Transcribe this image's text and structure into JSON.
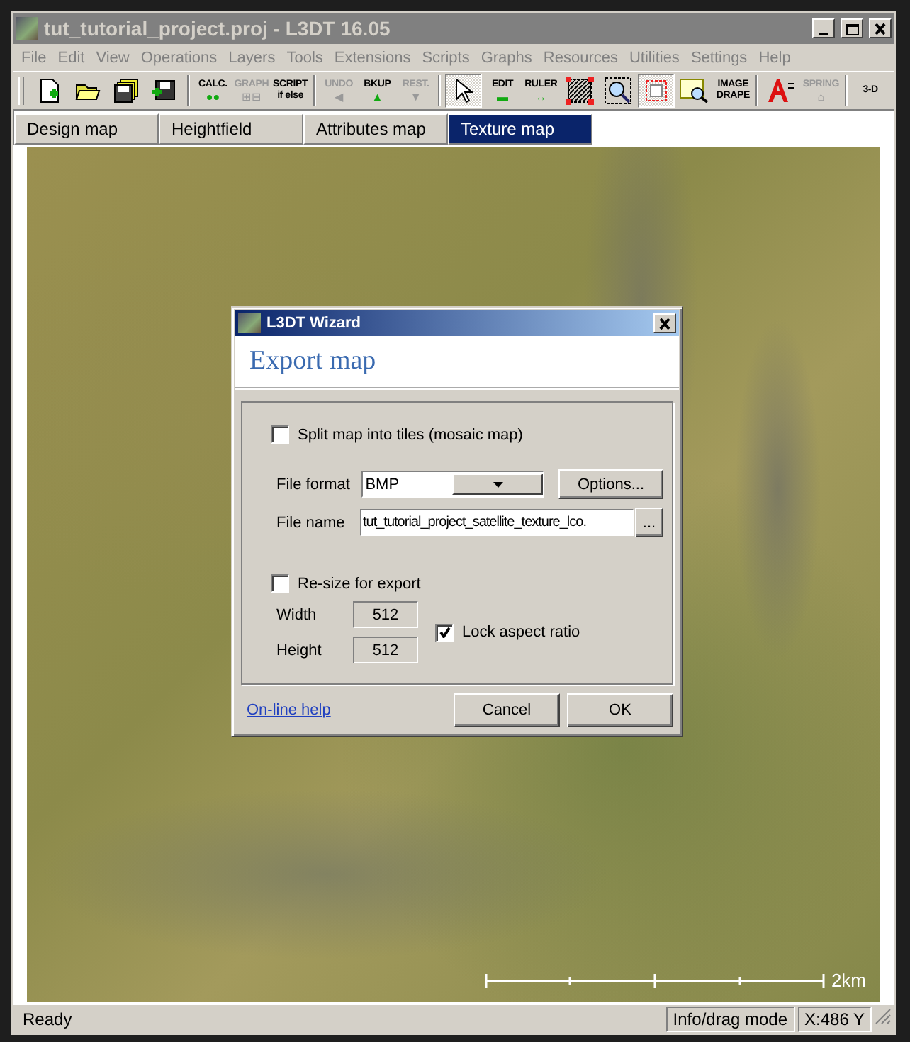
{
  "window": {
    "title": "tut_tutorial_project.proj - L3DT 16.05"
  },
  "menu": [
    "File",
    "Edit",
    "View",
    "Operations",
    "Layers",
    "Tools",
    "Extensions",
    "Scripts",
    "Graphs",
    "Resources",
    "Utilities",
    "Settings",
    "Help"
  ],
  "toolbar": [
    {
      "kind": "new",
      "disabled": false,
      "selected": false
    },
    {
      "kind": "open",
      "disabled": false,
      "selected": false
    },
    {
      "kind": "saveall",
      "disabled": false,
      "selected": false
    },
    {
      "kind": "save",
      "disabled": false,
      "selected": false
    },
    {
      "kind": "sep"
    },
    {
      "kind": "label",
      "label": "CALC.",
      "glyph": "●●",
      "disabled": false,
      "selected": false
    },
    {
      "kind": "label",
      "label": "GRAPH",
      "glyph": "⊞⊟",
      "disabled": true,
      "selected": false
    },
    {
      "kind": "label",
      "label": "SCRIPT",
      "sublabel": "if else",
      "disabled": false,
      "selected": false
    },
    {
      "kind": "sep"
    },
    {
      "kind": "label",
      "label": "UNDO",
      "glyph": "◀",
      "disabled": true,
      "selected": false
    },
    {
      "kind": "label",
      "label": "BKUP",
      "glyph": "▲",
      "disabled": false,
      "selected": false
    },
    {
      "kind": "label",
      "label": "REST.",
      "glyph": "▼",
      "disabled": true,
      "selected": false
    },
    {
      "kind": "sep"
    },
    {
      "kind": "pointer",
      "disabled": false,
      "selected": true
    },
    {
      "kind": "label",
      "label": "EDIT",
      "glyph": "▬",
      "disabled": false,
      "selected": false
    },
    {
      "kind": "label",
      "label": "RULER",
      "glyph": "↔",
      "disabled": false,
      "selected": false
    },
    {
      "kind": "select",
      "disabled": false,
      "selected": false
    },
    {
      "kind": "zoom",
      "disabled": false,
      "selected": false
    },
    {
      "kind": "frame",
      "disabled": false,
      "selected": true
    },
    {
      "kind": "view",
      "disabled": false,
      "selected": false
    },
    {
      "kind": "label",
      "label": "IMAGE",
      "sublabel": "DRAPE",
      "disabled": false,
      "selected": false
    },
    {
      "kind": "sep"
    },
    {
      "kind": "font",
      "disabled": false,
      "selected": false
    },
    {
      "kind": "label",
      "label": "SPRING",
      "glyph": "⌂",
      "disabled": true,
      "selected": false
    },
    {
      "kind": "sep"
    },
    {
      "kind": "label",
      "label": "3-D",
      "disabled": false,
      "selected": false
    }
  ],
  "tabs": [
    {
      "label": "Design map",
      "selected": false
    },
    {
      "label": "Heightfield",
      "selected": false
    },
    {
      "label": "Attributes map",
      "selected": false
    },
    {
      "label": "Texture map",
      "selected": true
    }
  ],
  "map": {
    "scale_label": "2km"
  },
  "dialog": {
    "title": "L3DT Wizard",
    "heading": "Export map",
    "split_tiles": {
      "label": "Split map into tiles (mosaic map)",
      "checked": false
    },
    "file_format": {
      "label": "File format",
      "value": "BMP"
    },
    "options_button": "Options...",
    "file_name": {
      "label": "File name",
      "value": "tut_tutorial_project_satellite_texture_lco."
    },
    "browse_button": "...",
    "resize": {
      "label": "Re-size for export",
      "checked": false
    },
    "width": {
      "label": "Width",
      "value": "512"
    },
    "height": {
      "label": "Height",
      "value": "512"
    },
    "lock_aspect": {
      "label": "Lock aspect ratio",
      "checked": true
    },
    "help_link": "On-line help",
    "buttons": [
      "Cancel",
      "OK"
    ]
  },
  "status_bar": [
    "Ready",
    "Info/drag mode",
    "X:486 Y"
  ]
}
